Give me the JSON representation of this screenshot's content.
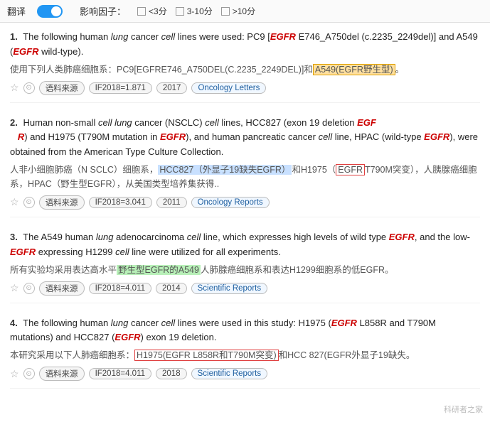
{
  "topBar": {
    "translateLabel": "翻译",
    "ifLabel": "影响因子：",
    "options": [
      {
        "label": "<3分",
        "checked": false
      },
      {
        "label": "3-10分",
        "checked": false
      },
      {
        "label": ">10分",
        "checked": false
      }
    ]
  },
  "results": [
    {
      "num": "1.",
      "en": "The following human <i>lung</i> cancer <i>cell</i> lines were used: PC9 [<b><i>EGFR</i></b> E746_A750del (c.2235_2249del)] and A549 (<b><i>EGFR</i></b> wild-type).",
      "zh": "使用下列人类肺癌细胞系：PC9[EGFRE746_A750DEL(C.2235_2249DEL)]和A549(EGFR野生型)。",
      "zhHighlight": {
        "text": "A549(EGFR野生型)",
        "type": "orange"
      },
      "year": "2017",
      "if": "IF2018=1.871",
      "journal": "Oncology Letters"
    },
    {
      "num": "2.",
      "en": "Human non-small <i>cell lung</i> cancer (NSCLC) <i>cell</i> lines, HCC827 (exon 19 deletion <b><i>EGF R</i></b>) and H1975 (T790M mutation in <b><i>EGFR</i></b>), and human pancreatic cancer <i>cell</i> line, HPAC (wild-type <b><i>EGFR</i></b>), were obtained from the American Type Culture Collection.",
      "zh": "人非小细胞肺癌（N SCLC）细胞系，HCC827（外显子19缺失EGFR）和H1975（EGFR T790M突变），人胰腺癌细胞系，HPAC（野生型EGFR），从美国类型培养集获得..",
      "zhHighlight1": {
        "text": "HCC827（外显子19缺失EGFR）",
        "type": "blue"
      },
      "zhHighlight2": {
        "text": "和H1975（EGFR",
        "type": "red-border"
      },
      "year": "2011",
      "if": "IF2018=3.041",
      "journal": "Oncology Reports"
    },
    {
      "num": "3.",
      "en": "The A549 human <i>lung</i> adenocarcinoma <i>cell</i> line, which expresses high levels of wild type <b><i>EGFR</i></b>, and the low-<b><i>EGFR</i></b> expressing H1299 <i>cell</i> line were utilized for all experiments.",
      "zh": "所有实验均采用表达高水平野生型EGFR的A549人肺腺癌细胞系和表达H1299细胞系的低EGFR。",
      "zhHighlight": {
        "text": "野生型EGFR的A549",
        "type": "green"
      },
      "year": "2014",
      "if": "IF2018=4.011",
      "journal": "Scientific Reports"
    },
    {
      "num": "4.",
      "en": "The following human <i>lung</i> cancer <i>cell</i> lines were used in this study: H1975 (<b><i>EGFR</i></b> L858R and T790M mutations) and HCC827 (<b><i>EGFR</i></b> exon 19 deletion.",
      "zh": "本研究采用以下人肺癌细胞系：H1975(EGFR L858R和T790M突变)和HCC 827(EGFR外显子19缺失。",
      "zhHighlight": {
        "text": "H1975(EGFR L858R和T790M突变)",
        "type": "red-border"
      },
      "year": "2018",
      "if": "IF2018=4.011",
      "journal": "Scientific Reports"
    }
  ],
  "watermark": "科研者之家"
}
